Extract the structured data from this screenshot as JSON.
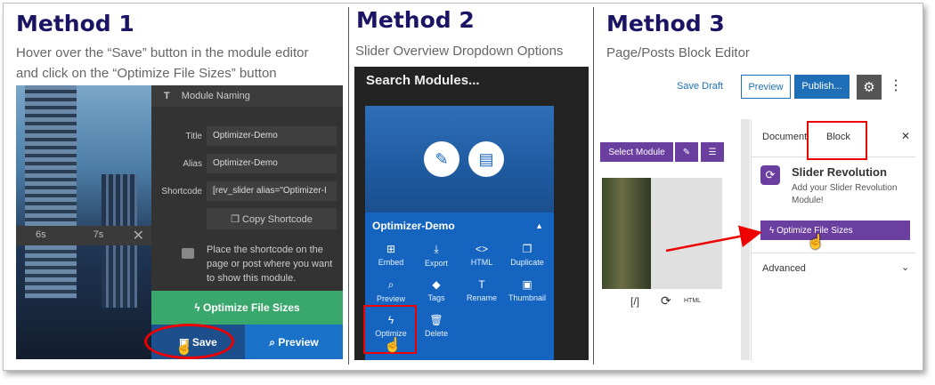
{
  "method1": {
    "heading": "Method 1",
    "description_line1": "Hover over the “Save” button in the module editor",
    "description_line2": "and click on the “Optimize File Sizes” button",
    "timeline": {
      "mark1": "6s",
      "mark2": "7s"
    },
    "module_naming": "Module Naming",
    "fields": [
      {
        "label": "Title",
        "value": "Optimizer-Demo"
      },
      {
        "label": "Alias",
        "value": "Optimizer-Demo"
      },
      {
        "label": "Shortcode",
        "value": "[rev_slider alias=\"Optimizer-I"
      }
    ],
    "copy_shortcode": "Copy Shortcode",
    "note": "Place the shortcode on the page or post where you want to show this module.",
    "optimize_label": "Optimize File Sizes",
    "save_label": "Save",
    "preview_label": "Preview"
  },
  "method2": {
    "heading": "Method 2",
    "description": "Slider Overview Dropdown Options",
    "search_label": "Search Modules...",
    "module_name": "Optimizer-Demo",
    "actions": [
      {
        "label": "Embed",
        "icon": "⊞"
      },
      {
        "label": "Export",
        "icon": "⤓"
      },
      {
        "label": "HTML",
        "icon": "<>"
      },
      {
        "label": "Duplicate",
        "icon": "❐"
      },
      {
        "label": "Preview",
        "icon": "⌕"
      },
      {
        "label": "Tags",
        "icon": "◆"
      },
      {
        "label": "Rename",
        "icon": "T"
      },
      {
        "label": "Thumbnail",
        "icon": "▣"
      },
      {
        "label": "Optimize",
        "icon": "ϟ"
      },
      {
        "label": "Delete",
        "icon": "🗑"
      }
    ]
  },
  "method3": {
    "heading": "Method 3",
    "description": "Page/Posts Block Editor",
    "save_draft": "Save Draft",
    "preview": "Preview",
    "publish": "Publish...",
    "select_module": "Select Module",
    "editor_toolbar_extra": [
      "[/]",
      "HTML"
    ],
    "tab_document": "Document",
    "tab_block": "Block",
    "block_title": "Slider Revolution",
    "block_desc": "Add your Slider Revolution Module!",
    "optimize_label": "Optimize File Sizes",
    "advanced": "Advanced"
  },
  "colors": {
    "heading": "#1b1464",
    "highlight_red": "#e00000",
    "purple": "#6b3fa0",
    "blue": "#1565c0",
    "green": "#3aa86c"
  }
}
